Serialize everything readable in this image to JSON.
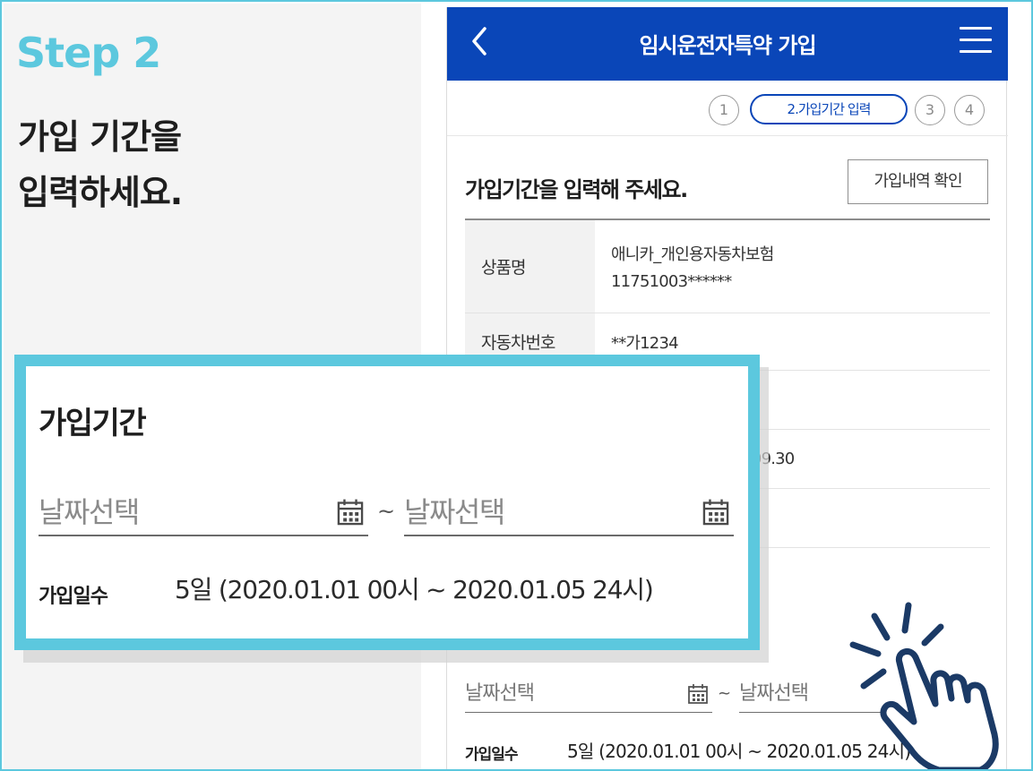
{
  "guide": {
    "step_label": "Step 2",
    "headline_line1": "가입 기간을",
    "headline_line2": "입력하세요."
  },
  "app_bar": {
    "title": "임시운전자특약 가입",
    "back_icon": "chevron-left-icon",
    "menu_icon": "hamburger-menu-icon",
    "color": "#0a46b8"
  },
  "steps": {
    "step1": "1",
    "step2_active": "2.가입기간 입력",
    "step3": "3",
    "step4": "4"
  },
  "section": {
    "title": "가입기간을 입력해 주세요.",
    "history_button": "가입내역 확인"
  },
  "info": {
    "product_label": "상품명",
    "product_name": "애니카_개인용자동차보험",
    "product_number": "11751003******",
    "car_label": "자동차번호",
    "car_number": "**가1234",
    "partial_date": ".09.30"
  },
  "zoom": {
    "title": "가입기간",
    "start_placeholder": "날짜선택",
    "end_placeholder": "날짜선택",
    "tilde": "~",
    "days_label": "가입일수",
    "days_value": "5일 (2020.01.01 00시 ~ 2020.01.05 24시)"
  },
  "form": {
    "start_placeholder": "날짜선택",
    "end_placeholder": "날짜선택",
    "tilde": "~",
    "days_label": "가입일수",
    "days_value": "5일 (2020.01.01 00시 ~ 2020.01.05 24시)"
  },
  "colors": {
    "accent": "#5cc8de",
    "brand_blue": "#0a46b8",
    "hand_outline": "#1b3a66"
  }
}
